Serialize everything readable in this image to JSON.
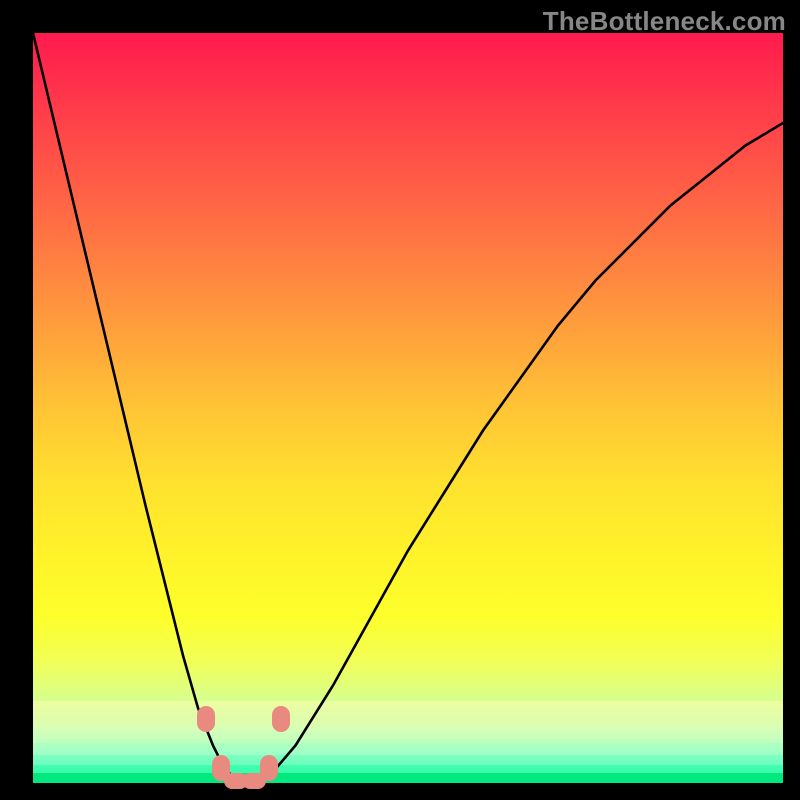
{
  "watermark": "TheBottleneck.com",
  "colors": {
    "gradient_top": "#ff1a4e",
    "gradient_mid": "#ffe12f",
    "gradient_bottom": "#00e97e",
    "curve": "#000000",
    "marker": "#e98a80",
    "frame": "#000000"
  },
  "chart_data": {
    "type": "line",
    "title": "",
    "xlabel": "",
    "ylabel": "",
    "xlim": [
      0,
      100
    ],
    "ylim": [
      0,
      100
    ],
    "x": [
      0,
      5,
      10,
      15,
      18,
      20,
      22,
      24,
      25,
      26,
      27,
      28,
      29,
      30,
      32,
      35,
      40,
      45,
      50,
      55,
      60,
      65,
      70,
      75,
      80,
      85,
      90,
      95,
      100
    ],
    "y": [
      100,
      79,
      58,
      37,
      25,
      17,
      10,
      5,
      3,
      1.5,
      0.5,
      0,
      0,
      0,
      1.5,
      5,
      13,
      22,
      31,
      39,
      47,
      54,
      61,
      67,
      72,
      77,
      81,
      85,
      88
    ],
    "series_name": "bottleneck-curve",
    "markers": [
      {
        "x": 23.0,
        "y": 8.5
      },
      {
        "x": 25.0,
        "y": 2.0
      },
      {
        "x": 27.0,
        "y": 0.3
      },
      {
        "x": 29.5,
        "y": 0.3
      },
      {
        "x": 31.5,
        "y": 2.0
      },
      {
        "x": 33.0,
        "y": 8.5
      }
    ],
    "note": "Values estimated from pixel positions; chart has no axis ticks or labels."
  }
}
